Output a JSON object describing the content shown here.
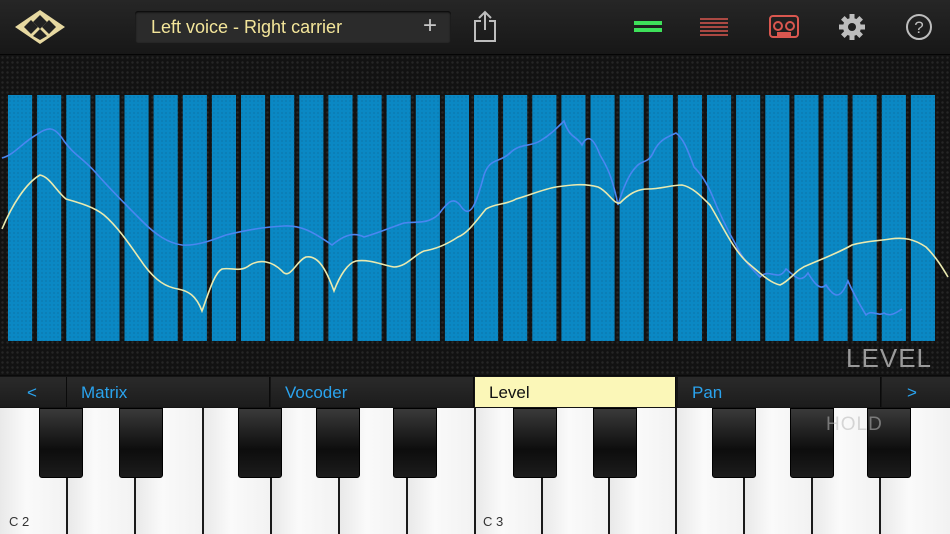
{
  "toolbar": {
    "preset_name": "Left voice - Right carrier",
    "add_symbol": "+",
    "icons": [
      "app-logo-icon",
      "share-icon",
      "channels-icon",
      "spectrum-icon",
      "recorder-icon",
      "gear-icon",
      "help-icon"
    ],
    "help_symbol": "?"
  },
  "display": {
    "mode_label": "LEVEL",
    "band_count": 32,
    "colors": {
      "band": "#0a88c4",
      "voice_curve": "#4a86f0",
      "carrier_curve": "#eaeab0"
    }
  },
  "tabs": {
    "prev_symbol": "<",
    "next_symbol": ">",
    "items": [
      {
        "label": "Matrix",
        "active": false
      },
      {
        "label": "Vocoder",
        "active": false
      },
      {
        "label": "Level",
        "active": true
      },
      {
        "label": "Pan",
        "active": false
      }
    ]
  },
  "keyboard": {
    "note_labels": [
      "C 2",
      "C 3"
    ],
    "hold_label": "HOLD"
  }
}
